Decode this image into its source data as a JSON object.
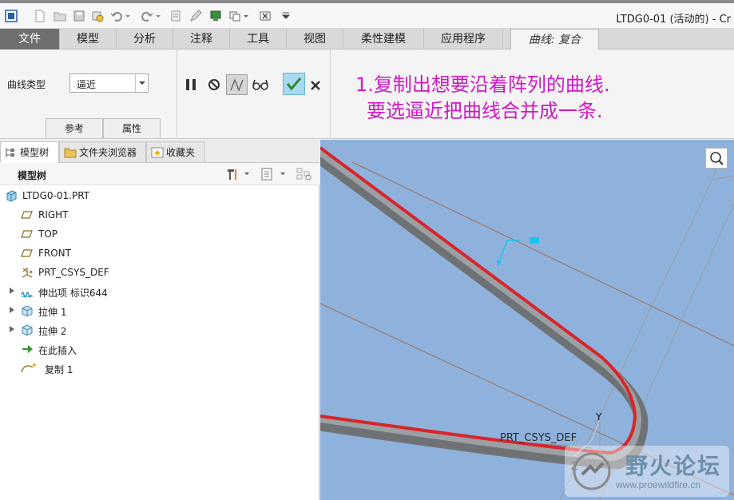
{
  "window": {
    "title": "LTDG0-01 (活动的) - Cr"
  },
  "tabs": [
    {
      "label": "文件"
    },
    {
      "label": "模型"
    },
    {
      "label": "分析"
    },
    {
      "label": "注释"
    },
    {
      "label": "工具"
    },
    {
      "label": "视图"
    },
    {
      "label": "柔性建模"
    },
    {
      "label": "应用程序"
    },
    {
      "label": "曲线: 复合"
    }
  ],
  "ribbon": {
    "curve_type_label": "曲线类型",
    "curve_type_value": "逼近",
    "subtabs": [
      {
        "label": "参考"
      },
      {
        "label": "属性"
      }
    ]
  },
  "instruction": {
    "line1": "1.复制出想要沿着阵列的曲线.",
    "line2": "要选逼近把曲线合并成一条."
  },
  "navigator": {
    "tabs": [
      {
        "label": "模型树"
      },
      {
        "label": "文件夹浏览器"
      },
      {
        "label": "收藏夹"
      }
    ],
    "tree_title": "模型树"
  },
  "model_tree": [
    {
      "label": "LTDG0-01.PRT",
      "icon": "part-icon"
    },
    {
      "label": "RIGHT",
      "icon": "datum-plane-icon"
    },
    {
      "label": "TOP",
      "icon": "datum-plane-icon"
    },
    {
      "label": "FRONT",
      "icon": "datum-plane-icon"
    },
    {
      "label": "PRT_CSYS_DEF",
      "icon": "csys-icon"
    },
    {
      "label": "伸出项 标识644",
      "icon": "protrusion-icon",
      "expandable": true
    },
    {
      "label": "拉伸 1",
      "icon": "extrude-icon",
      "expandable": true
    },
    {
      "label": "拉伸 2",
      "icon": "extrude-icon",
      "expandable": true
    },
    {
      "label": "在此插入",
      "icon": "insert-here-arrow-icon"
    },
    {
      "label": "复制 1",
      "icon": "copy-curve-icon"
    }
  ],
  "viewport": {
    "csys_label": "PRT_CSYS_DEF",
    "axis_y": "Y",
    "axis_z": "Z",
    "curve_color": "#d9242a",
    "background_color": "#8fb2dc"
  },
  "watermark": {
    "text": "野火论坛",
    "url": "www.proewildfire.cn"
  }
}
